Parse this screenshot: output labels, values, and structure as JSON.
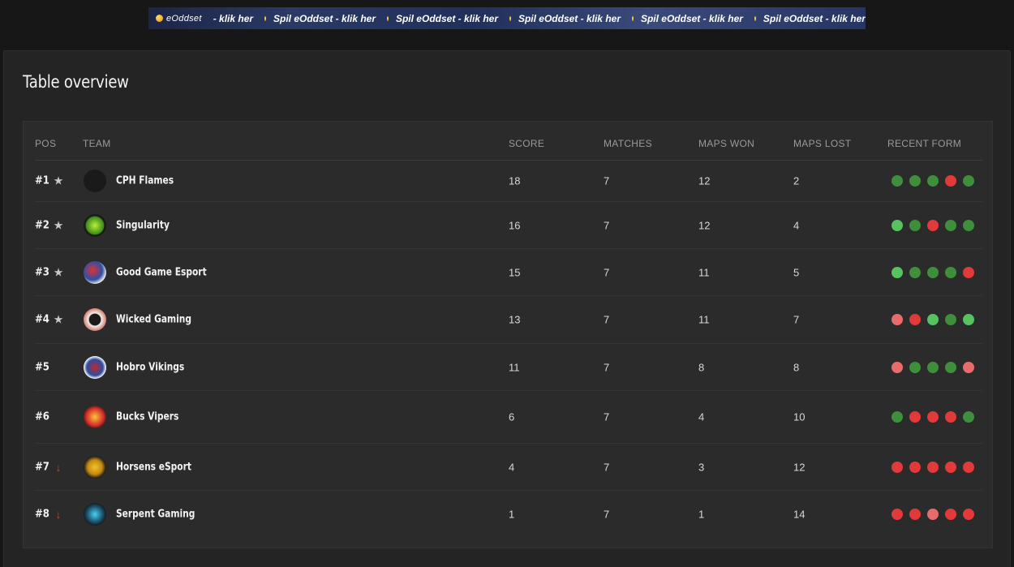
{
  "banner": {
    "brand": "eOddset",
    "slogan": "Spil eOddset - klik her",
    "first_tail": "- klik her"
  },
  "title": "Table overview",
  "colors": {
    "win": "#3f8e3c",
    "win_light": "#57c260",
    "loss": "#e23a3a",
    "loss_light": "#e86c6c"
  },
  "columns": {
    "pos": "POS",
    "team": "TEAM",
    "score": "SCORE",
    "matches": "MATCHES",
    "maps_won": "MAPS WON",
    "maps_lost": "MAPS LOST",
    "recent_form": "RECENT FORM"
  },
  "rows": [
    {
      "pos": "#1",
      "marker": "star-icon",
      "team": "CPH Flames",
      "score": "18",
      "matches": "7",
      "maps_won": "12",
      "maps_lost": "2",
      "form": [
        "win",
        "win",
        "win",
        "loss",
        "win"
      ]
    },
    {
      "pos": "#2",
      "marker": "star-icon",
      "team": "Singularity",
      "score": "16",
      "matches": "7",
      "maps_won": "12",
      "maps_lost": "4",
      "form": [
        "win_light",
        "win",
        "loss",
        "win",
        "win"
      ]
    },
    {
      "pos": "#3",
      "marker": "star-icon",
      "team": "Good Game Esport",
      "score": "15",
      "matches": "7",
      "maps_won": "11",
      "maps_lost": "5",
      "form": [
        "win_light",
        "win",
        "win",
        "win",
        "loss"
      ]
    },
    {
      "pos": "#4",
      "marker": "star-icon",
      "team": "Wicked Gaming",
      "score": "13",
      "matches": "7",
      "maps_won": "11",
      "maps_lost": "7",
      "form": [
        "loss_light",
        "loss",
        "win_light",
        "win",
        "win_light"
      ]
    },
    {
      "pos": "#5",
      "marker": "",
      "team": "Hobro Vikings",
      "score": "11",
      "matches": "7",
      "maps_won": "8",
      "maps_lost": "8",
      "form": [
        "loss_light",
        "win",
        "win",
        "win",
        "loss_light"
      ]
    },
    {
      "pos": "#6",
      "marker": "",
      "team": "Bucks Vipers",
      "score": "6",
      "matches": "7",
      "maps_won": "4",
      "maps_lost": "10",
      "form": [
        "win",
        "loss",
        "loss",
        "loss",
        "win"
      ]
    },
    {
      "pos": "#7",
      "marker": "arrow-down-icon",
      "team": "Horsens eSport",
      "score": "4",
      "matches": "7",
      "maps_won": "3",
      "maps_lost": "12",
      "form": [
        "loss",
        "loss",
        "loss",
        "loss",
        "loss"
      ]
    },
    {
      "pos": "#8",
      "marker": "arrow-down-icon",
      "team": "Serpent Gaming",
      "score": "1",
      "matches": "7",
      "maps_won": "1",
      "maps_lost": "14",
      "form": [
        "loss",
        "loss",
        "loss_light",
        "loss",
        "loss"
      ]
    }
  ]
}
